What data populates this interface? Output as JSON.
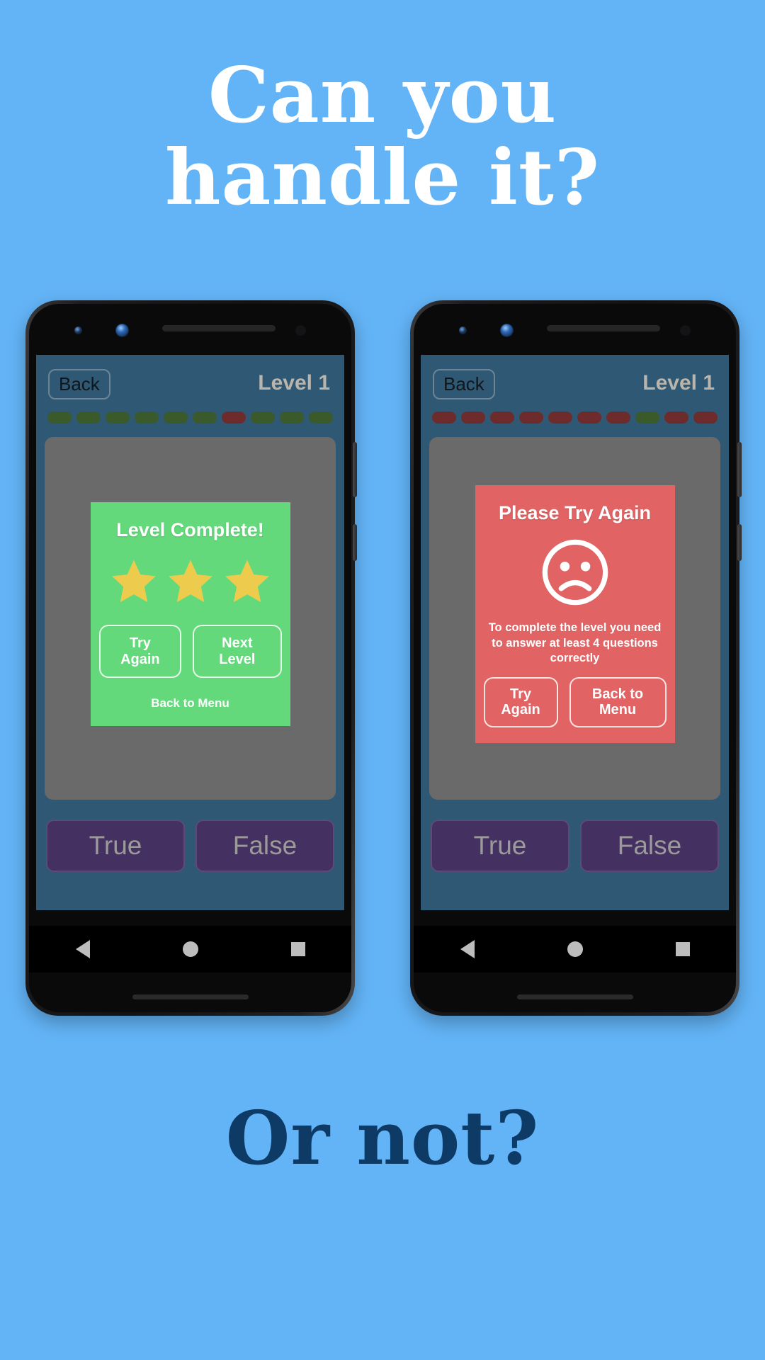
{
  "page": {
    "background_color": "#63b4f7",
    "headline_top_lines": [
      "Can you",
      "handle it?"
    ],
    "headline_top_color": "#ffffff",
    "headline_bottom": "Or not?",
    "headline_bottom_color": "#0d3b66"
  },
  "phones": [
    {
      "id": "left",
      "app": {
        "screen_background": "#2e5873",
        "header": {
          "back_label": "Back",
          "level_label": "Level 1"
        },
        "progress_dots": [
          "green",
          "green",
          "green",
          "green",
          "green",
          "green",
          "red",
          "green",
          "green",
          "green"
        ],
        "dialog": {
          "kind": "success",
          "background_color": "#63d97b",
          "title": "Level Complete!",
          "stars": 3,
          "star_color": "#edcb4d",
          "buttons": [
            "Try Again",
            "Next Level"
          ],
          "link": "Back to Menu"
        },
        "answer_buttons": [
          "True",
          "False"
        ]
      }
    },
    {
      "id": "right",
      "app": {
        "screen_background": "#2e5873",
        "header": {
          "back_label": "Back",
          "level_label": "Level 1"
        },
        "progress_dots": [
          "red",
          "red",
          "red",
          "red",
          "red",
          "red",
          "red",
          "green",
          "red",
          "red"
        ],
        "dialog": {
          "kind": "fail",
          "background_color": "#e16363",
          "title": "Please Try Again",
          "icon": "sad-face-icon",
          "message": "To complete the level you need to answer at least 4 questions correctly",
          "buttons": [
            "Try Again",
            "Back to Menu"
          ]
        },
        "answer_buttons": [
          "True",
          "False"
        ]
      }
    }
  ],
  "nav_bar": {
    "back_icon": "triangle-back-icon",
    "home_icon": "circle-home-icon",
    "recents_icon": "square-recents-icon"
  }
}
